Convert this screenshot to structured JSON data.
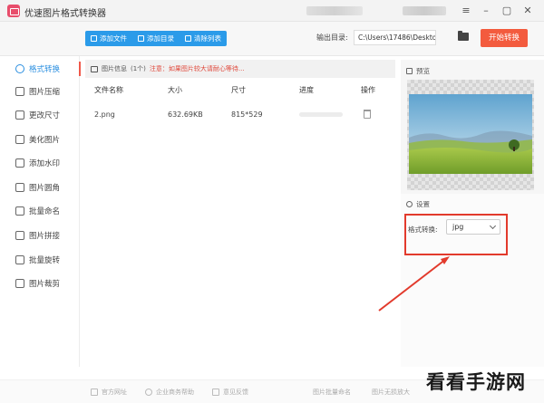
{
  "window": {
    "title": "优速图片格式转换器"
  },
  "toolbar": {
    "add_file": "添加文件",
    "add_folder": "添加目录",
    "clear_list": "清除列表",
    "output_label": "输出目录:",
    "output_path": "C:\\Users\\17486\\Deskto",
    "start_button": "开始转换"
  },
  "sidebar": {
    "items": [
      {
        "label": "格式转换",
        "icon": "format-icon",
        "active": true
      },
      {
        "label": "图片压缩",
        "icon": "compress-icon"
      },
      {
        "label": "更改尺寸",
        "icon": "resize-icon"
      },
      {
        "label": "美化图片",
        "icon": "beautify-icon"
      },
      {
        "label": "添加水印",
        "icon": "watermark-icon"
      },
      {
        "label": "图片圆角",
        "icon": "round-corner-icon"
      },
      {
        "label": "批量命名",
        "icon": "rename-icon"
      },
      {
        "label": "图片拼接",
        "icon": "stitch-icon"
      },
      {
        "label": "批量旋转",
        "icon": "rotate-icon"
      },
      {
        "label": "图片裁剪",
        "icon": "crop-icon"
      }
    ]
  },
  "file_list": {
    "info_title": "图片信息",
    "info_count": "(1个)",
    "info_warning": "注意：如果图片较大请耐心等待...",
    "columns": {
      "name": "文件名称",
      "size": "大小",
      "dimensions": "尺寸",
      "progress": "进度",
      "actions": "操作"
    },
    "rows": [
      {
        "name": "2.png",
        "size": "632.69KB",
        "dimensions": "815*529",
        "progress": 0
      }
    ]
  },
  "preview": {
    "title": "预览"
  },
  "settings": {
    "title": "设置",
    "format_label": "格式转换:",
    "format_value": "jpg"
  },
  "footer": {
    "official_site": "官方网址",
    "enterprise_help": "企业商务帮助",
    "feedback": "意见反馈",
    "right_a": "图片批量命名",
    "right_b": "图片无损放大"
  },
  "watermark": "看看手游网",
  "colors": {
    "accent": "#2b9be9",
    "start_button": "#f35b3e",
    "highlight": "#e23a2c"
  }
}
